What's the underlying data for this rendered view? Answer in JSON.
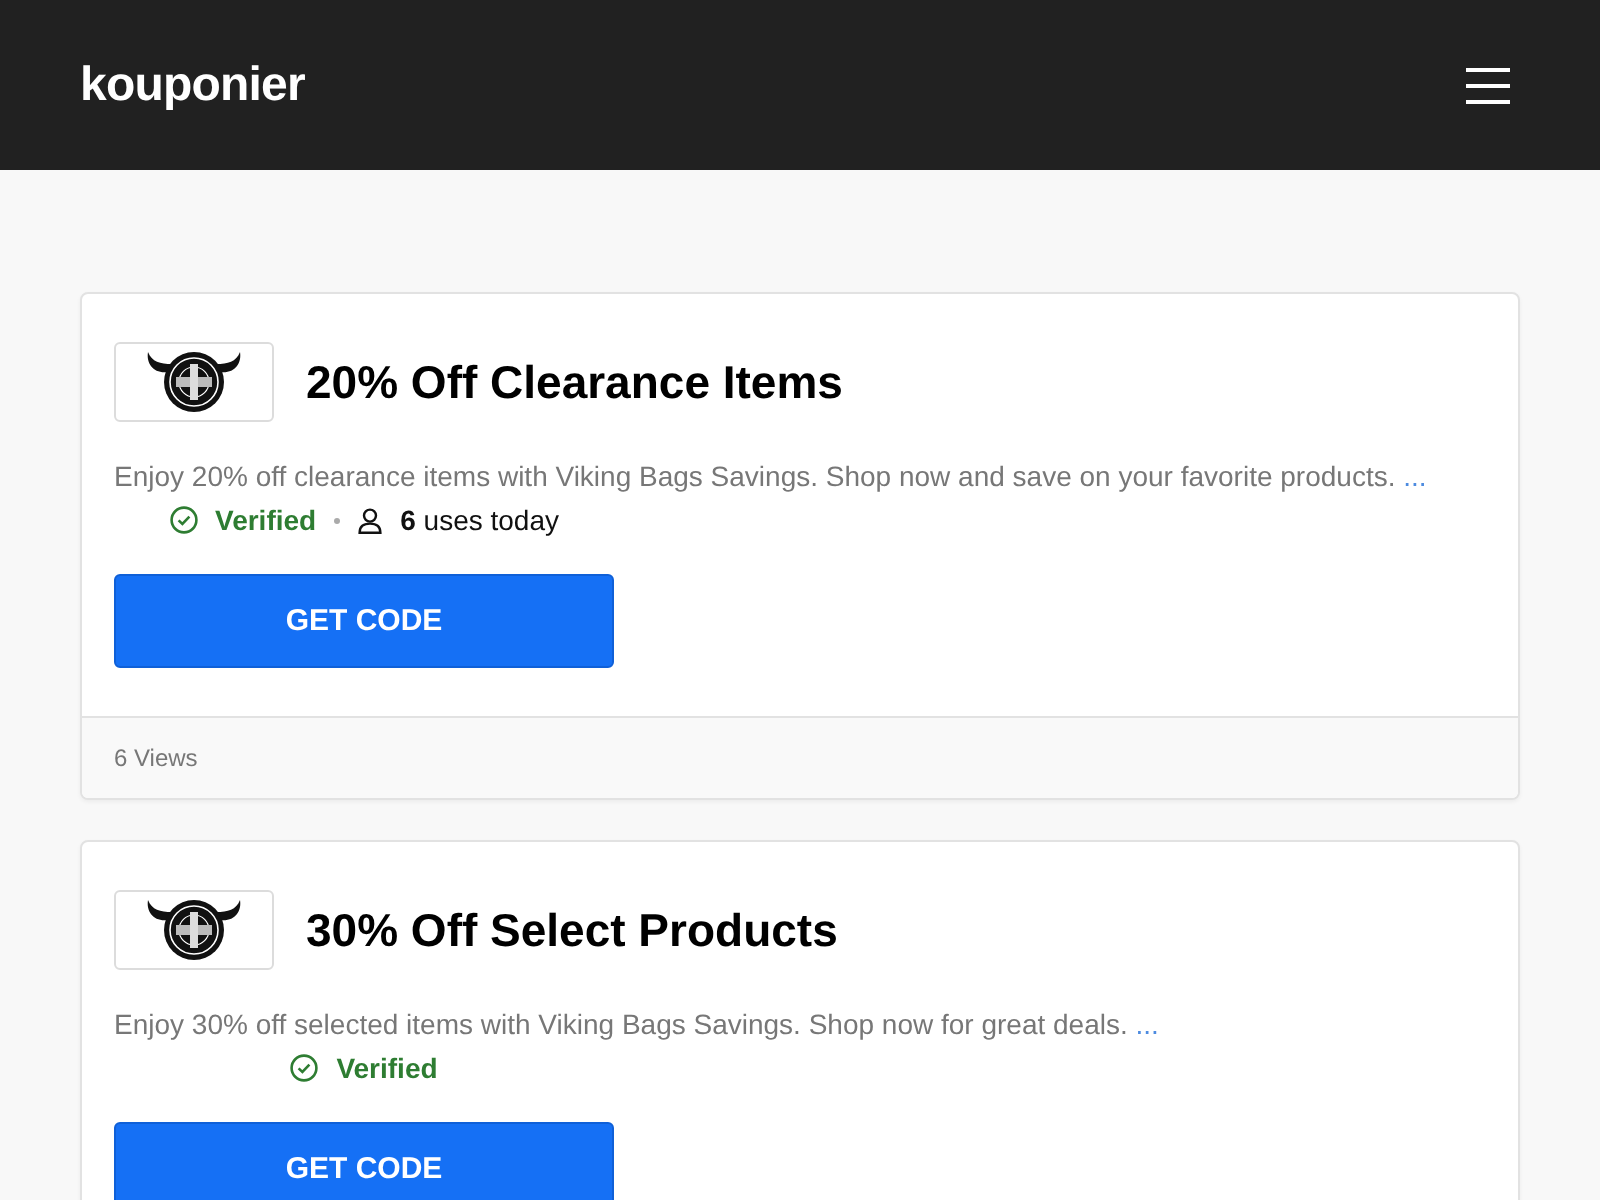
{
  "header": {
    "logo": "kouponier"
  },
  "coupons": [
    {
      "title": "20% Off Clearance Items",
      "description": "Enjoy 20% off clearance items with Viking Bags Savings. Shop now and save on your favorite products.",
      "more_link": "...",
      "verified": "Verified",
      "uses": "**6** uses today",
      "button": "GET CODE",
      "views": "6 Views"
    },
    {
      "title": "30% Off Select Products",
      "description": "Enjoy 30% off selected items with Viking Bags Savings. Shop now for great deals.",
      "more_link": "...",
      "verified": "Verified",
      "button": "GET CODE"
    }
  ]
}
